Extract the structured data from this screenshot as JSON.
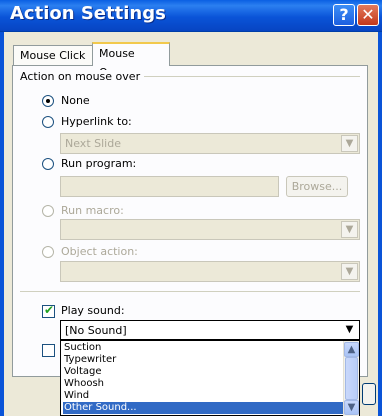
{
  "window": {
    "title": "Action Settings"
  },
  "tabs": [
    {
      "label": "Mouse Click",
      "active": false
    },
    {
      "label": "Mouse Over",
      "active": true
    }
  ],
  "group": {
    "label": "Action on mouse over"
  },
  "options": {
    "none": {
      "label": "None",
      "selected": true
    },
    "hyperlink": {
      "label": "Hyperlink to:",
      "value": "Next Slide"
    },
    "run_program": {
      "label": "Run program:",
      "value": "",
      "browse_label": "Browse..."
    },
    "run_macro": {
      "label": "Run macro:",
      "value": ""
    },
    "object_action": {
      "label": "Object action:",
      "value": ""
    }
  },
  "play_sound": {
    "label": "Play sound:",
    "checked": true,
    "value": "[No Sound]"
  },
  "sound_list": {
    "items": [
      "Suction",
      "Typewriter",
      "Voltage",
      "Whoosh",
      "Wind",
      "Other Sound..."
    ],
    "selected_index": 5
  },
  "colors": {
    "title_bar": "#0a54d8",
    "selection": "#316ac5",
    "tab_highlight": "#f2c94c"
  }
}
